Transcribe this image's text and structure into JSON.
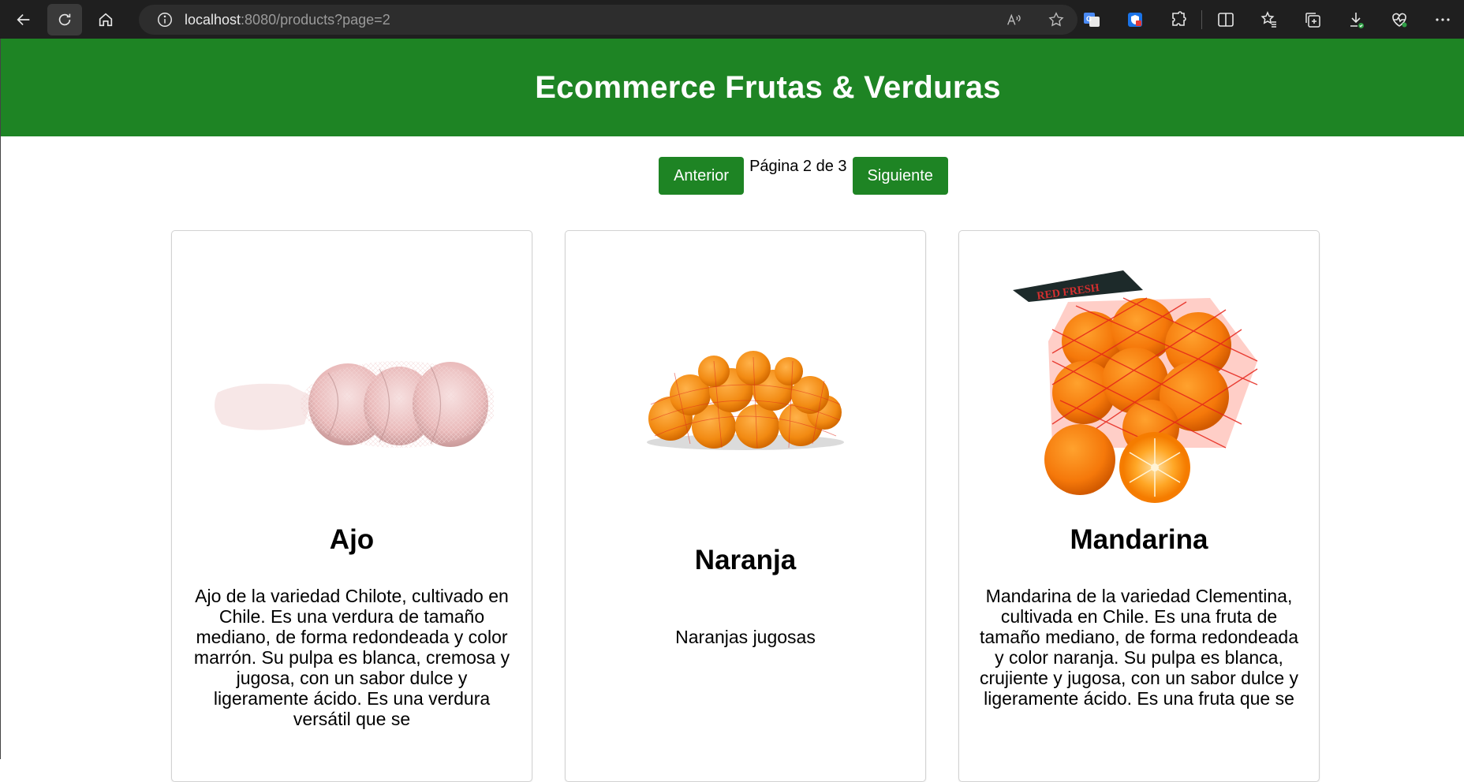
{
  "browser": {
    "url_host": "localhost",
    "url_rest": ":8080/products?page=2",
    "read_aloud_label": "A",
    "translate_label": "G"
  },
  "header": {
    "title": "Ecommerce Frutas & Verduras",
    "background_color": "#1e8424"
  },
  "pagination": {
    "prev_label": "Anterior",
    "indicator": "Página 2 de 3",
    "next_label": "Siguiente"
  },
  "products": [
    {
      "name": "Ajo",
      "description": "Ajo de la variedad Chilote, cultivado en Chile. Es una verdura de tamaño mediano, de forma redondeada y color marrón. Su pulpa es blanca, cremosa y jugosa, con un sabor dulce y ligeramente ácido. Es una verdura versátil que se",
      "image_icon": "garlic-net-image"
    },
    {
      "name": "Naranja",
      "description": "Naranjas jugosas",
      "image_icon": "oranges-net-image"
    },
    {
      "name": "Mandarina",
      "description": "Mandarina de la variedad Clementina, cultivada en Chile. Es una fruta de tamaño mediano, de forma redondeada y color naranja. Su pulpa es blanca, crujiente y jugosa, con un sabor dulce y ligeramente ácido. Es una fruta que se",
      "image_icon": "mandarins-net-image",
      "image_tag_text": "RED FRESH"
    }
  ]
}
